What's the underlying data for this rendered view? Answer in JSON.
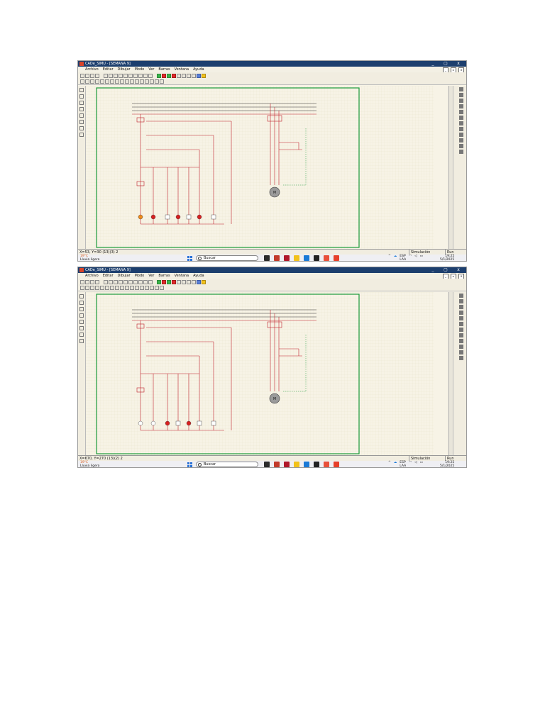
{
  "screenshots": [
    {
      "window_title": "CADe_SIMU - [SEMANA 9]",
      "menu": [
        "Archivo",
        "Editar",
        "Dibujar",
        "Modo",
        "Ver",
        "Barras",
        "Ventana",
        "Ayuda"
      ],
      "window_buttons": [
        "_",
        "▢",
        "x"
      ],
      "mdi_buttons": [
        "_",
        "▫",
        "x"
      ],
      "status": {
        "coords": "X=53, Y=30 (13)(3) 2",
        "simulation": "Simulación",
        "mode": "Run"
      },
      "taskbar": {
        "weather_temp": "19°C",
        "weather_text": "Lluvia ligera",
        "search": "Buscar",
        "lang1": "ESP",
        "lang2": "LAA",
        "time": "19:25",
        "date": "5/1/2025"
      }
    },
    {
      "window_title": "CADe_SIMU - [SEMANA 9]",
      "menu": [
        "Archivo",
        "Editar",
        "Dibujar",
        "Modo",
        "Ver",
        "Barras",
        "Ventana",
        "Ayuda"
      ],
      "window_buttons": [
        "_",
        "▢",
        "x"
      ],
      "mdi_buttons": [
        "_",
        "▫",
        "x"
      ],
      "status": {
        "coords": "X=670, Y=270 (13)(2) 2",
        "simulation": "Simulación",
        "mode": "Run"
      },
      "taskbar": {
        "weather_temp": "19°C",
        "weather_text": "Lluvia ligera",
        "search": "Buscar",
        "lang1": "ESP",
        "lang2": "LAA",
        "time": "19:25",
        "date": "5/1/2025"
      }
    }
  ],
  "colors": {
    "circuit_line": "#c0202a",
    "neutral_line": "#333333",
    "frame_green": "#1a9a3a",
    "lamp_red": "#d82020",
    "lamp_orange": "#f08a1a",
    "motor_gray": "#9a9a9a"
  }
}
